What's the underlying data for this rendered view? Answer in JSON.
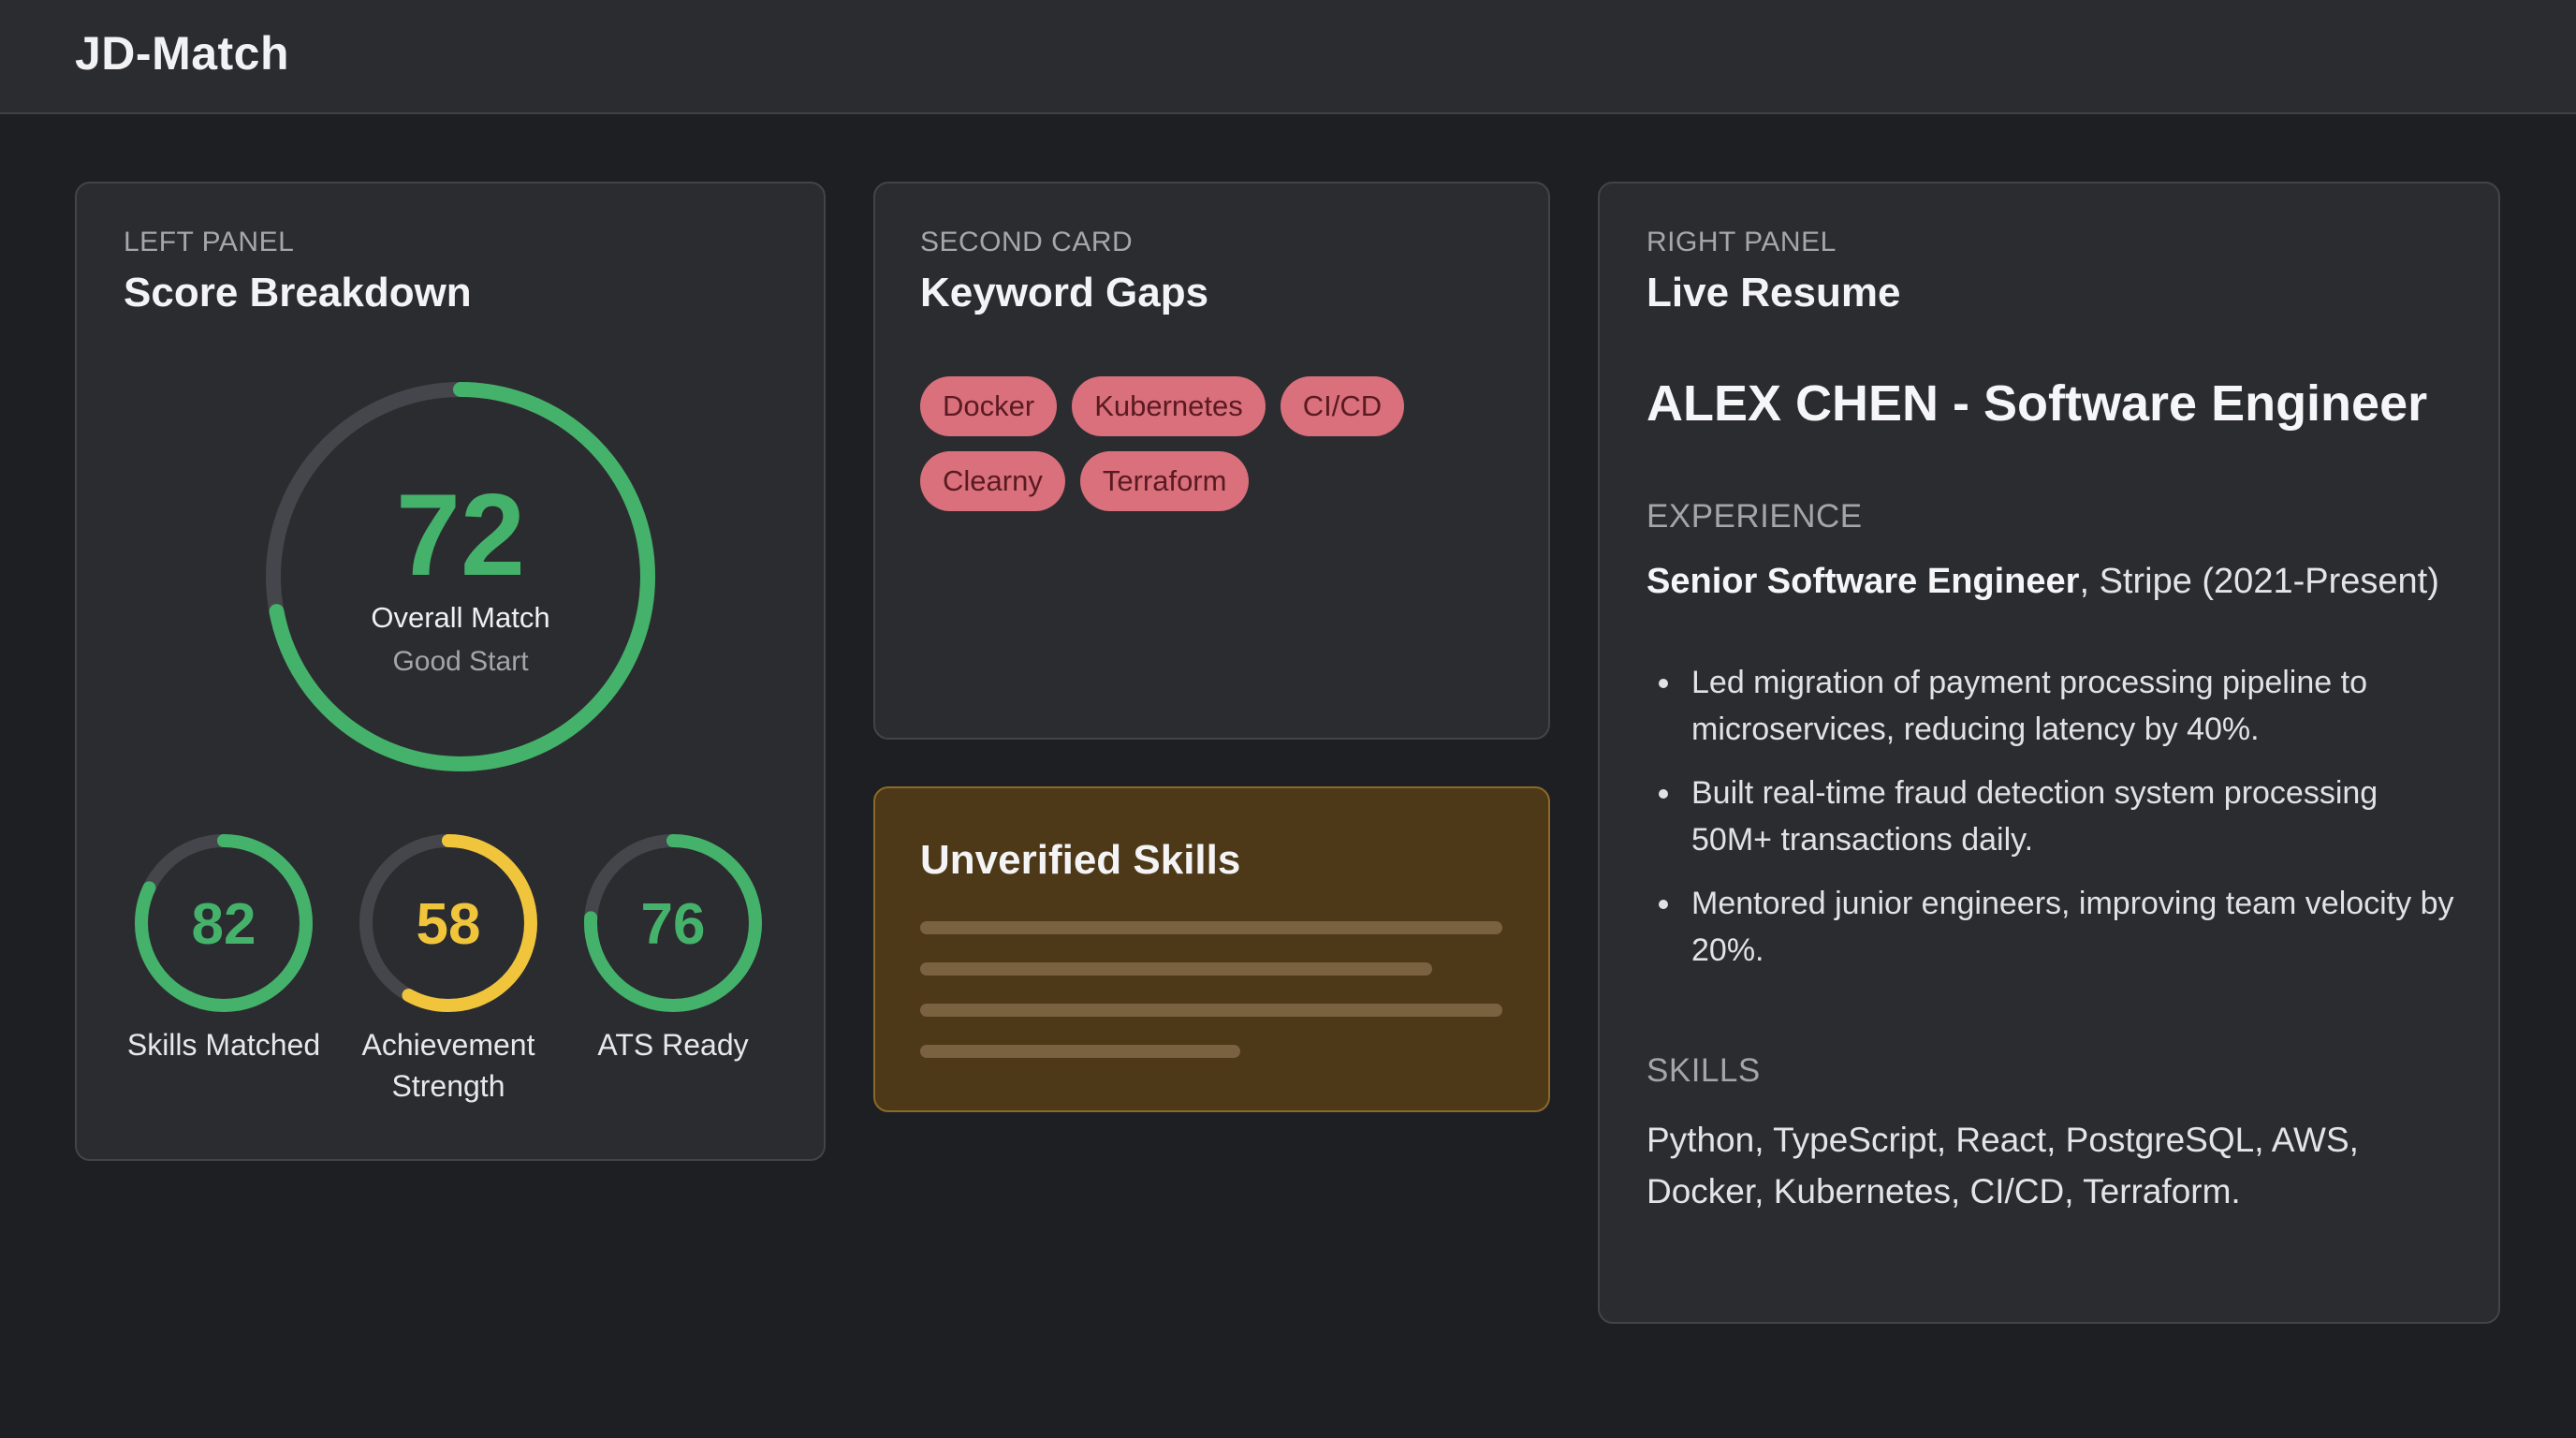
{
  "app": {
    "title": "JD-Match"
  },
  "score_panel": {
    "eyebrow": "LEFT PANEL",
    "title": "Score Breakdown",
    "overall": {
      "value": "72",
      "label": "Overall Match",
      "sublabel": "Good Start",
      "percent": 72,
      "color": "#44b26a"
    },
    "sub_scores": [
      {
        "value": "82",
        "label_lines": [
          "Skills Matched"
        ],
        "percent": 82,
        "color": "#44b26a"
      },
      {
        "value": "58",
        "label_lines": [
          "Achievement",
          "Strength"
        ],
        "percent": 58,
        "color": "#f1c53b"
      },
      {
        "value": "76",
        "label_lines": [
          "ATS Ready"
        ],
        "percent": 76,
        "color": "#44b26a"
      }
    ]
  },
  "keyword_gaps": {
    "eyebrow": "SECOND CARD",
    "title": "Keyword Gaps",
    "chips": [
      "Docker",
      "Kubernetes",
      "CI/CD",
      "Clearny",
      "Terraform"
    ]
  },
  "unverified": {
    "title": "Unverified Skills",
    "placeholder_line_fractions": [
      1.0,
      0.88,
      1.0,
      0.55
    ]
  },
  "resume": {
    "eyebrow": "RIGHT PANEL",
    "title": "Live Resume",
    "name": "ALEX CHEN - Software Engineer",
    "experience_heading": "EXPERIENCE",
    "job_title": "Senior Software Engineer",
    "job_company": ", Stripe (2021-Present)",
    "bullets": [
      "Led migration of payment processing pipeline to microservices, reducing latency by 40%.",
      "Built real-time fraud detection system processing 50M+ transactions daily.",
      "Mentored junior engineers, improving team velocity by 20%."
    ],
    "skills_heading": "SKILLS",
    "skills_text": "Python, TypeScript, React, PostgreSQL, AWS, Docker, Kubernetes, CI/CD, Terraform."
  },
  "colors": {
    "track": "#45464c",
    "green": "#44b26a",
    "yellow": "#f1c53b",
    "chip_bg": "#d9707c",
    "warning_bg": "#4d3917"
  }
}
